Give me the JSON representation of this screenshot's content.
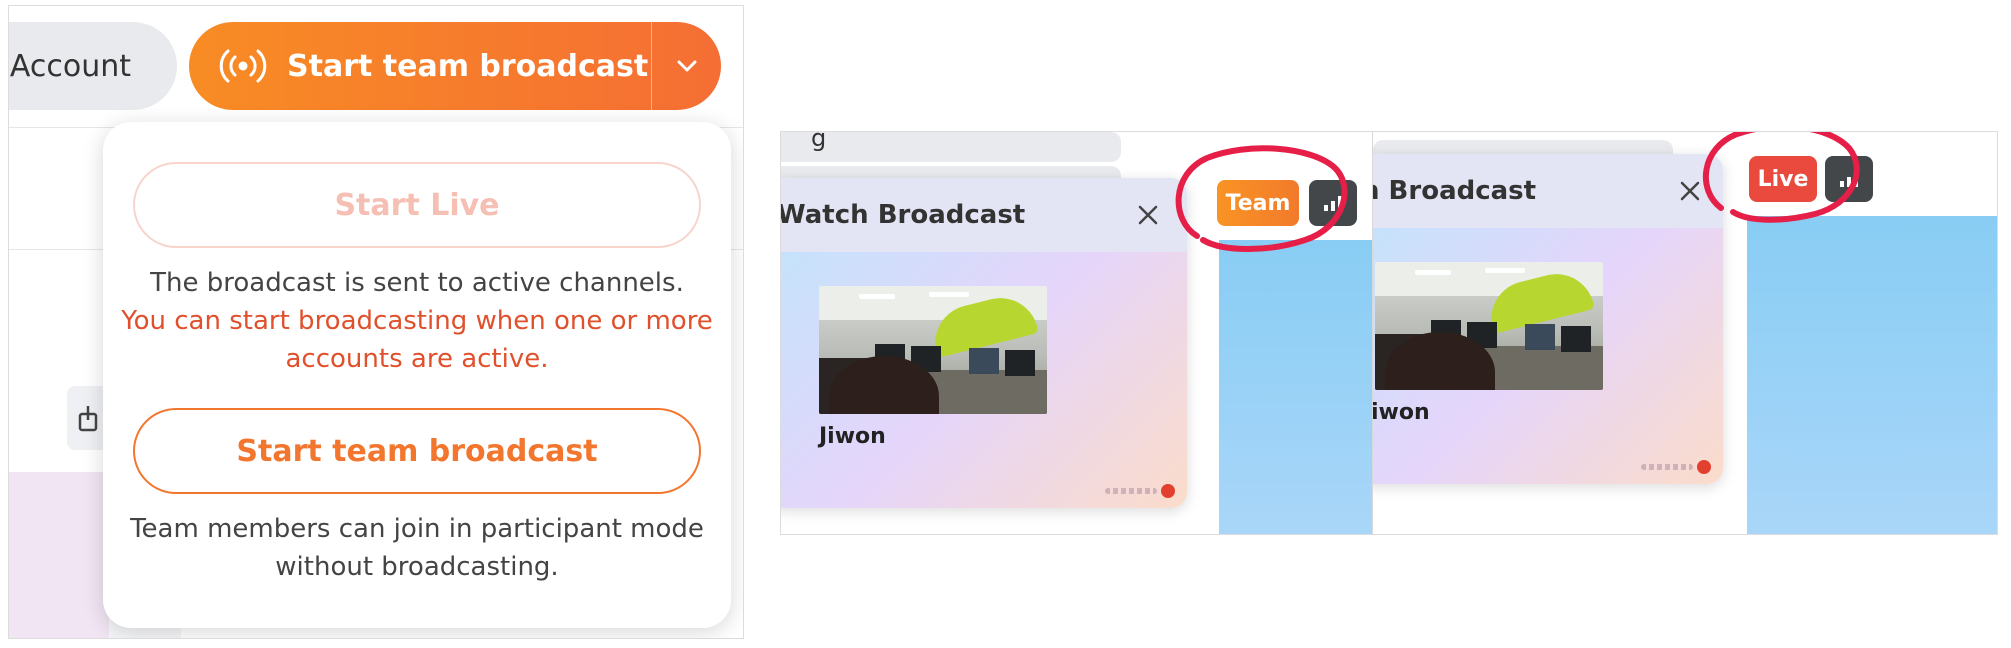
{
  "left_panel": {
    "account_label": "Account",
    "broadcast_button": {
      "label": "Start team broadcast",
      "color_start": "#f88c24",
      "color_end": "#f56e34"
    },
    "dropdown": {
      "start_live_label": "Start Live",
      "start_live_desc": "The broadcast is sent to active channels.",
      "start_live_warning": "You can start broadcasting when one or more accounts are active.",
      "start_team_label": "Start team broadcast",
      "start_team_desc": "Team members can join in participant mode without broadcasting."
    }
  },
  "right_panel": {
    "team_capture": {
      "partial_label": "g",
      "card_title": "Watch Broadcast",
      "participant_name": "Jiwon",
      "badge_label": "Team",
      "badge_color": "#f78a26",
      "icons": [
        "close-icon",
        "signal-icon"
      ]
    },
    "live_capture": {
      "card_title": "n Broadcast",
      "participant_name": "iwon",
      "badge_label": "Live",
      "badge_color": "#ea4a3e",
      "icons": [
        "close-icon",
        "signal-icon"
      ]
    },
    "highlight_color": "#e51f47"
  }
}
